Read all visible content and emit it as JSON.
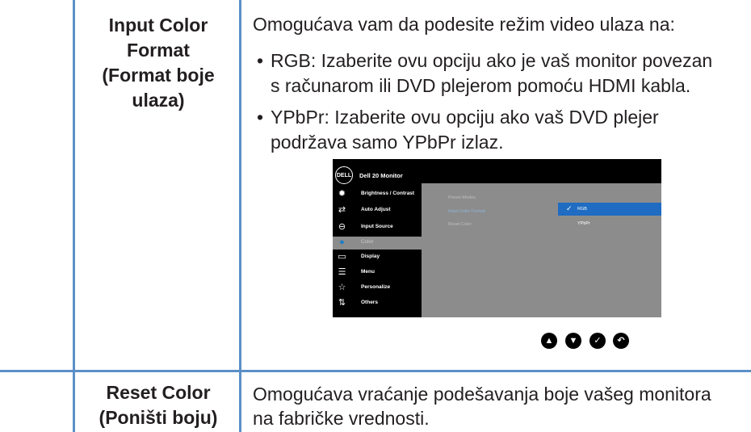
{
  "rows": [
    {
      "term_lines": [
        "Input Color",
        "Format",
        "(Format boje",
        "ulaza)"
      ],
      "intro": "Omogućava vam da podesite režim video ulaza na:",
      "bullets": [
        {
          "lines": [
            "RGB: Izaberite ovu opciju ako je vaš monitor povezan",
            "s računarom ili DVD plejerom pomoću HDMI kabla."
          ]
        },
        {
          "lines": [
            "YPbPr: Izaberite ovu opciju ako vaš DVD plejer",
            "podržava samo YPbPr izlaz."
          ]
        }
      ]
    },
    {
      "term_lines": [
        "Reset Color",
        "(Poništi boju)"
      ],
      "desc_lines": [
        "Omogućava vraćanje podešavanja boje vašeg monitora",
        "na fabričke vrednosti."
      ]
    }
  ],
  "bullet_char": "•",
  "osd": {
    "logo": "DELL",
    "title": "Dell 20 Monitor",
    "menu": [
      {
        "icon": "brightness-icon",
        "glyph": "✹",
        "label": "Brightness / Contrast"
      },
      {
        "icon": "auto-adjust-icon",
        "glyph": "⇄",
        "label": "Auto Adjust"
      },
      {
        "icon": "input-source-icon",
        "glyph": "⊖",
        "label": "Input Source"
      },
      {
        "icon": "color-icon",
        "glyph": "●",
        "label": "Color",
        "active": true
      },
      {
        "icon": "display-icon",
        "glyph": "▭",
        "label": "Display"
      },
      {
        "icon": "menu-icon",
        "glyph": "☰",
        "label": "Menu"
      },
      {
        "icon": "personalize-icon",
        "glyph": "☆",
        "label": "Personalize"
      },
      {
        "icon": "others-icon",
        "glyph": "⇅",
        "label": "Others"
      }
    ],
    "submenu": [
      {
        "label": "Preset Modes"
      },
      {
        "label": "Input Color Format",
        "selected": true
      },
      {
        "label": "Reset Color"
      }
    ],
    "choices": [
      {
        "label": "RGB",
        "selected": true,
        "check": "✓"
      },
      {
        "label": "YPbPr"
      }
    ],
    "colors": {
      "accent": "#1f6cc2",
      "panel": "#8c8c8c",
      "sidebar": "#000000"
    }
  },
  "nav_buttons": [
    {
      "icon": "up-arrow-icon",
      "glyph": "▲"
    },
    {
      "icon": "down-arrow-icon",
      "glyph": "▼"
    },
    {
      "icon": "confirm-check-icon",
      "glyph": "✓"
    },
    {
      "icon": "back-return-icon",
      "glyph": "↶"
    }
  ],
  "table_line_color": "#5b8fc7"
}
